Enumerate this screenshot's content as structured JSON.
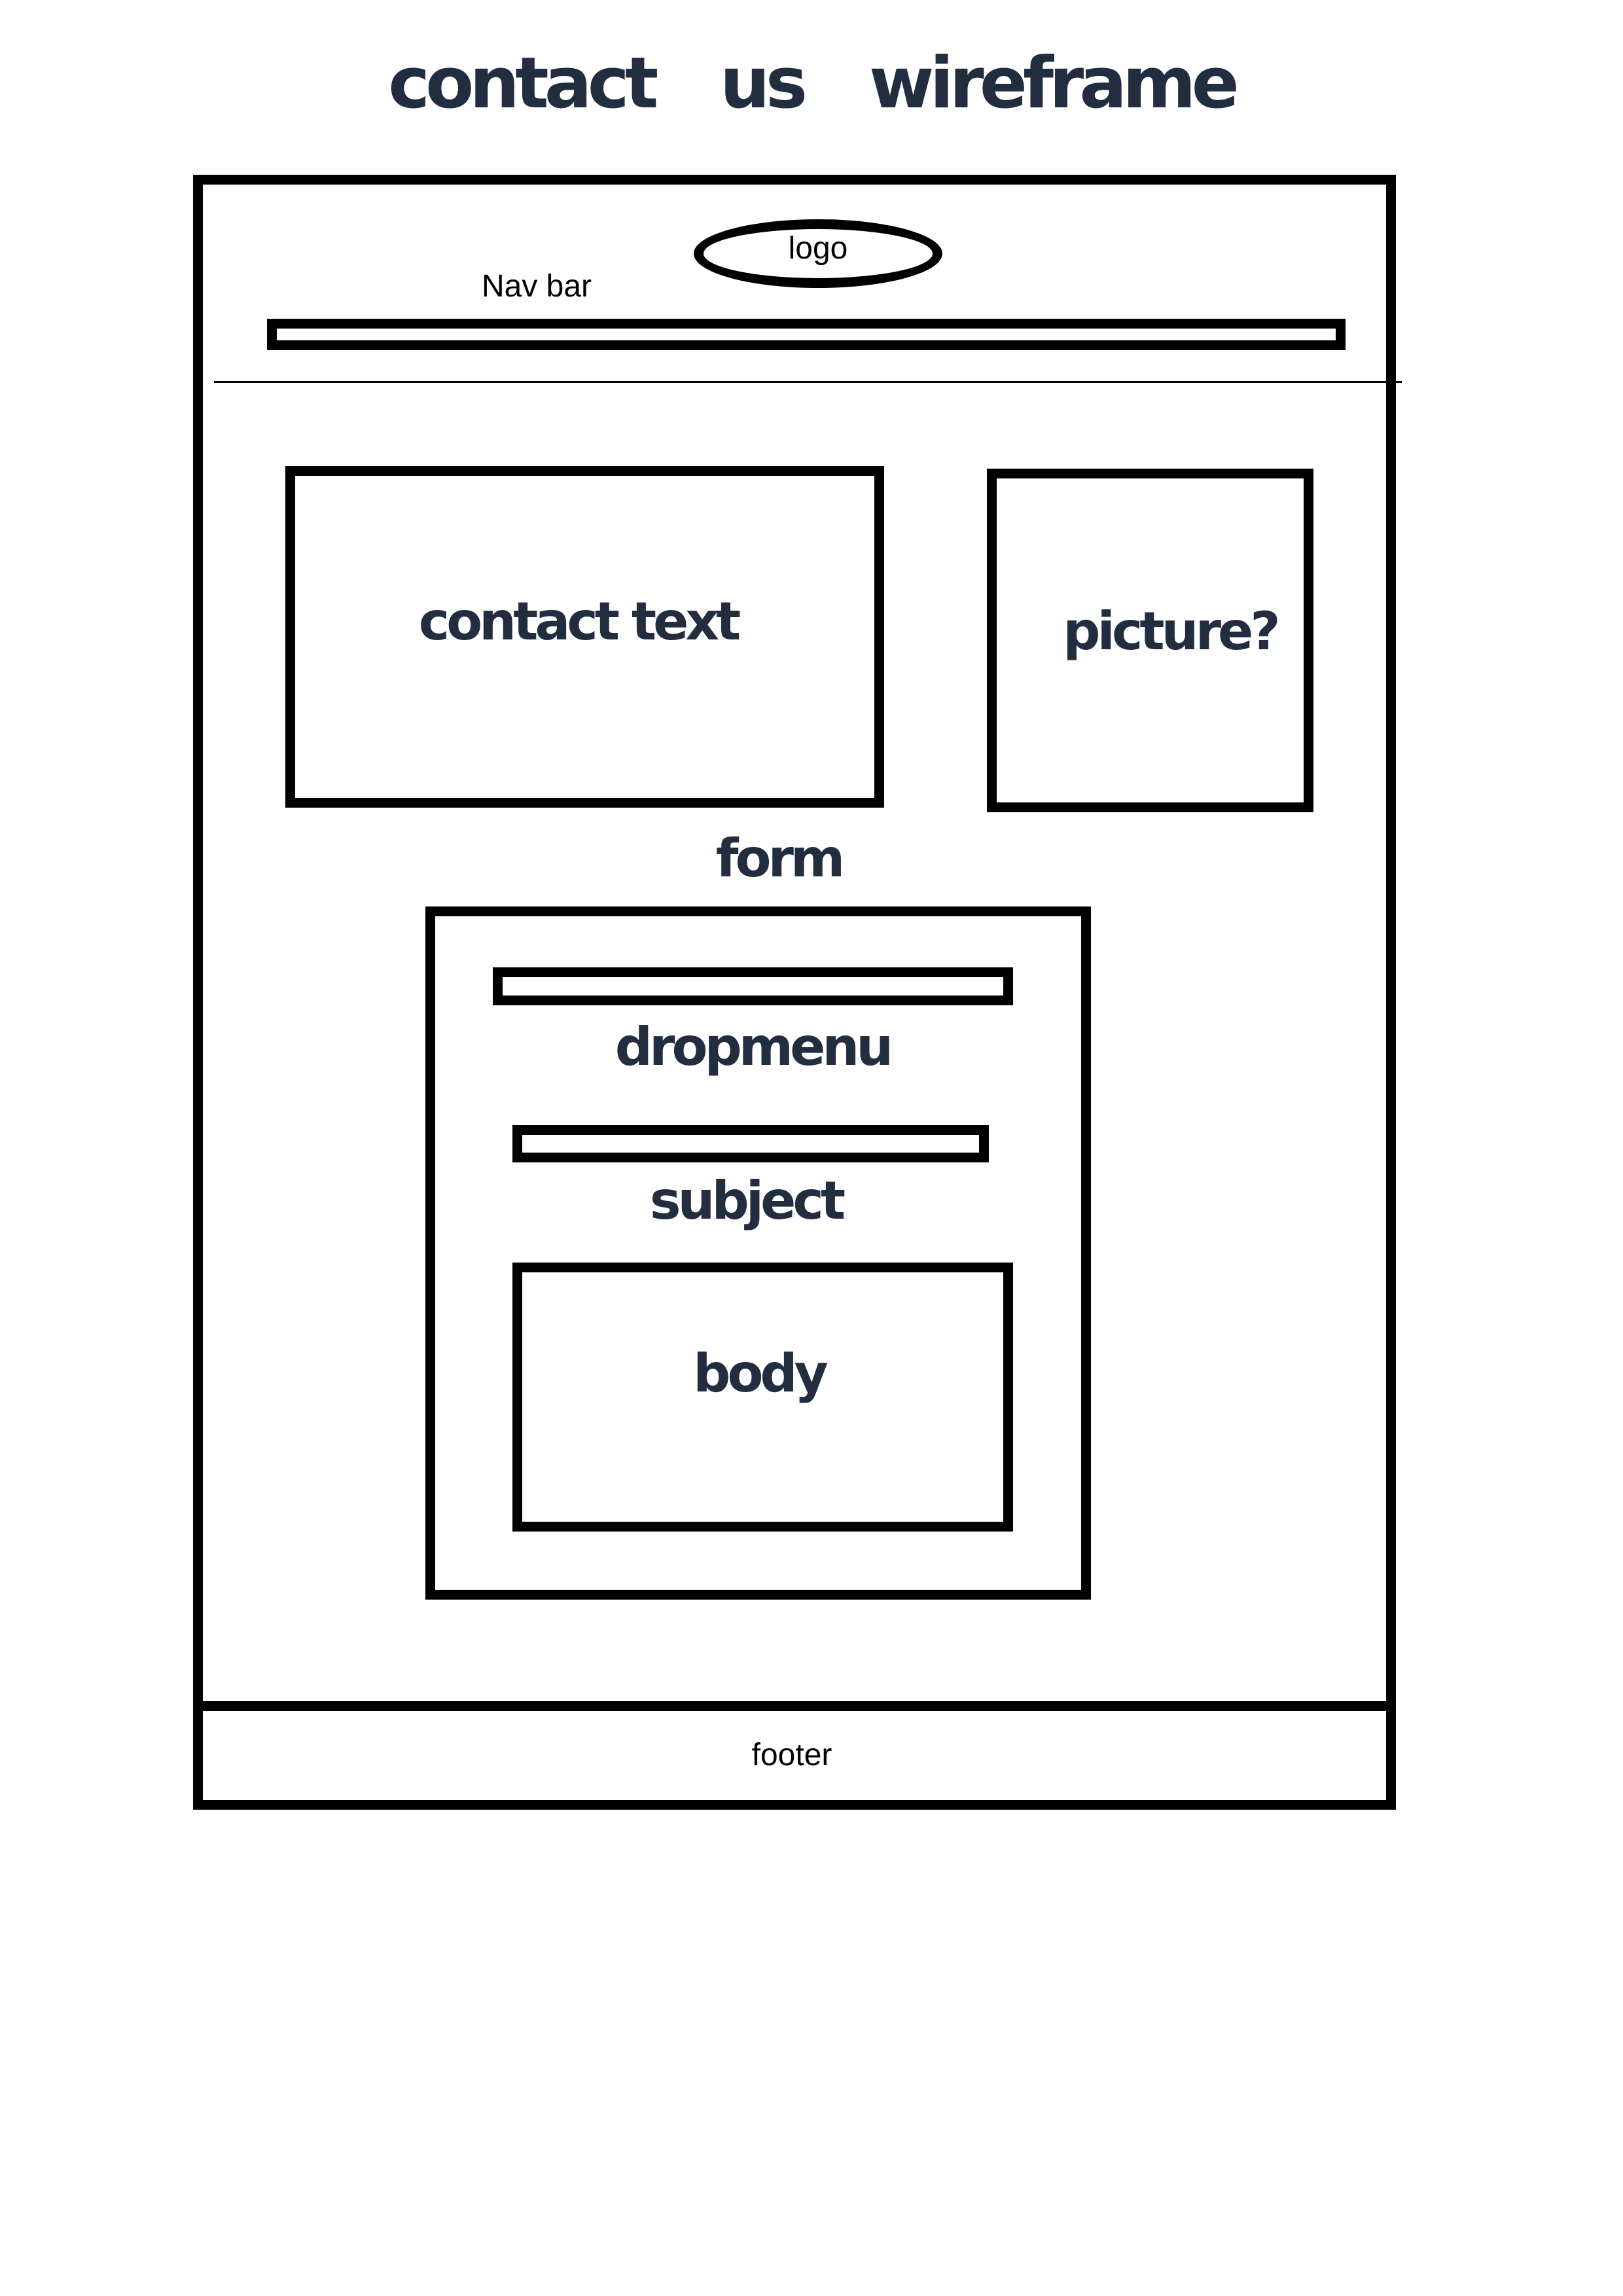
{
  "title": "contact us   wireframe",
  "colors": {
    "heading": "#232d40",
    "line": "#000000",
    "background": "#ffffff"
  },
  "header": {
    "logo_label": "logo",
    "nav_label": "Nav bar"
  },
  "content": {
    "contact_text_label": "contact text",
    "picture_label": "picture?"
  },
  "form": {
    "label": "form",
    "dropmenu_label": "dropmenu",
    "subject_label": "subject",
    "body_label": "body"
  },
  "footer": {
    "label": "footer"
  }
}
